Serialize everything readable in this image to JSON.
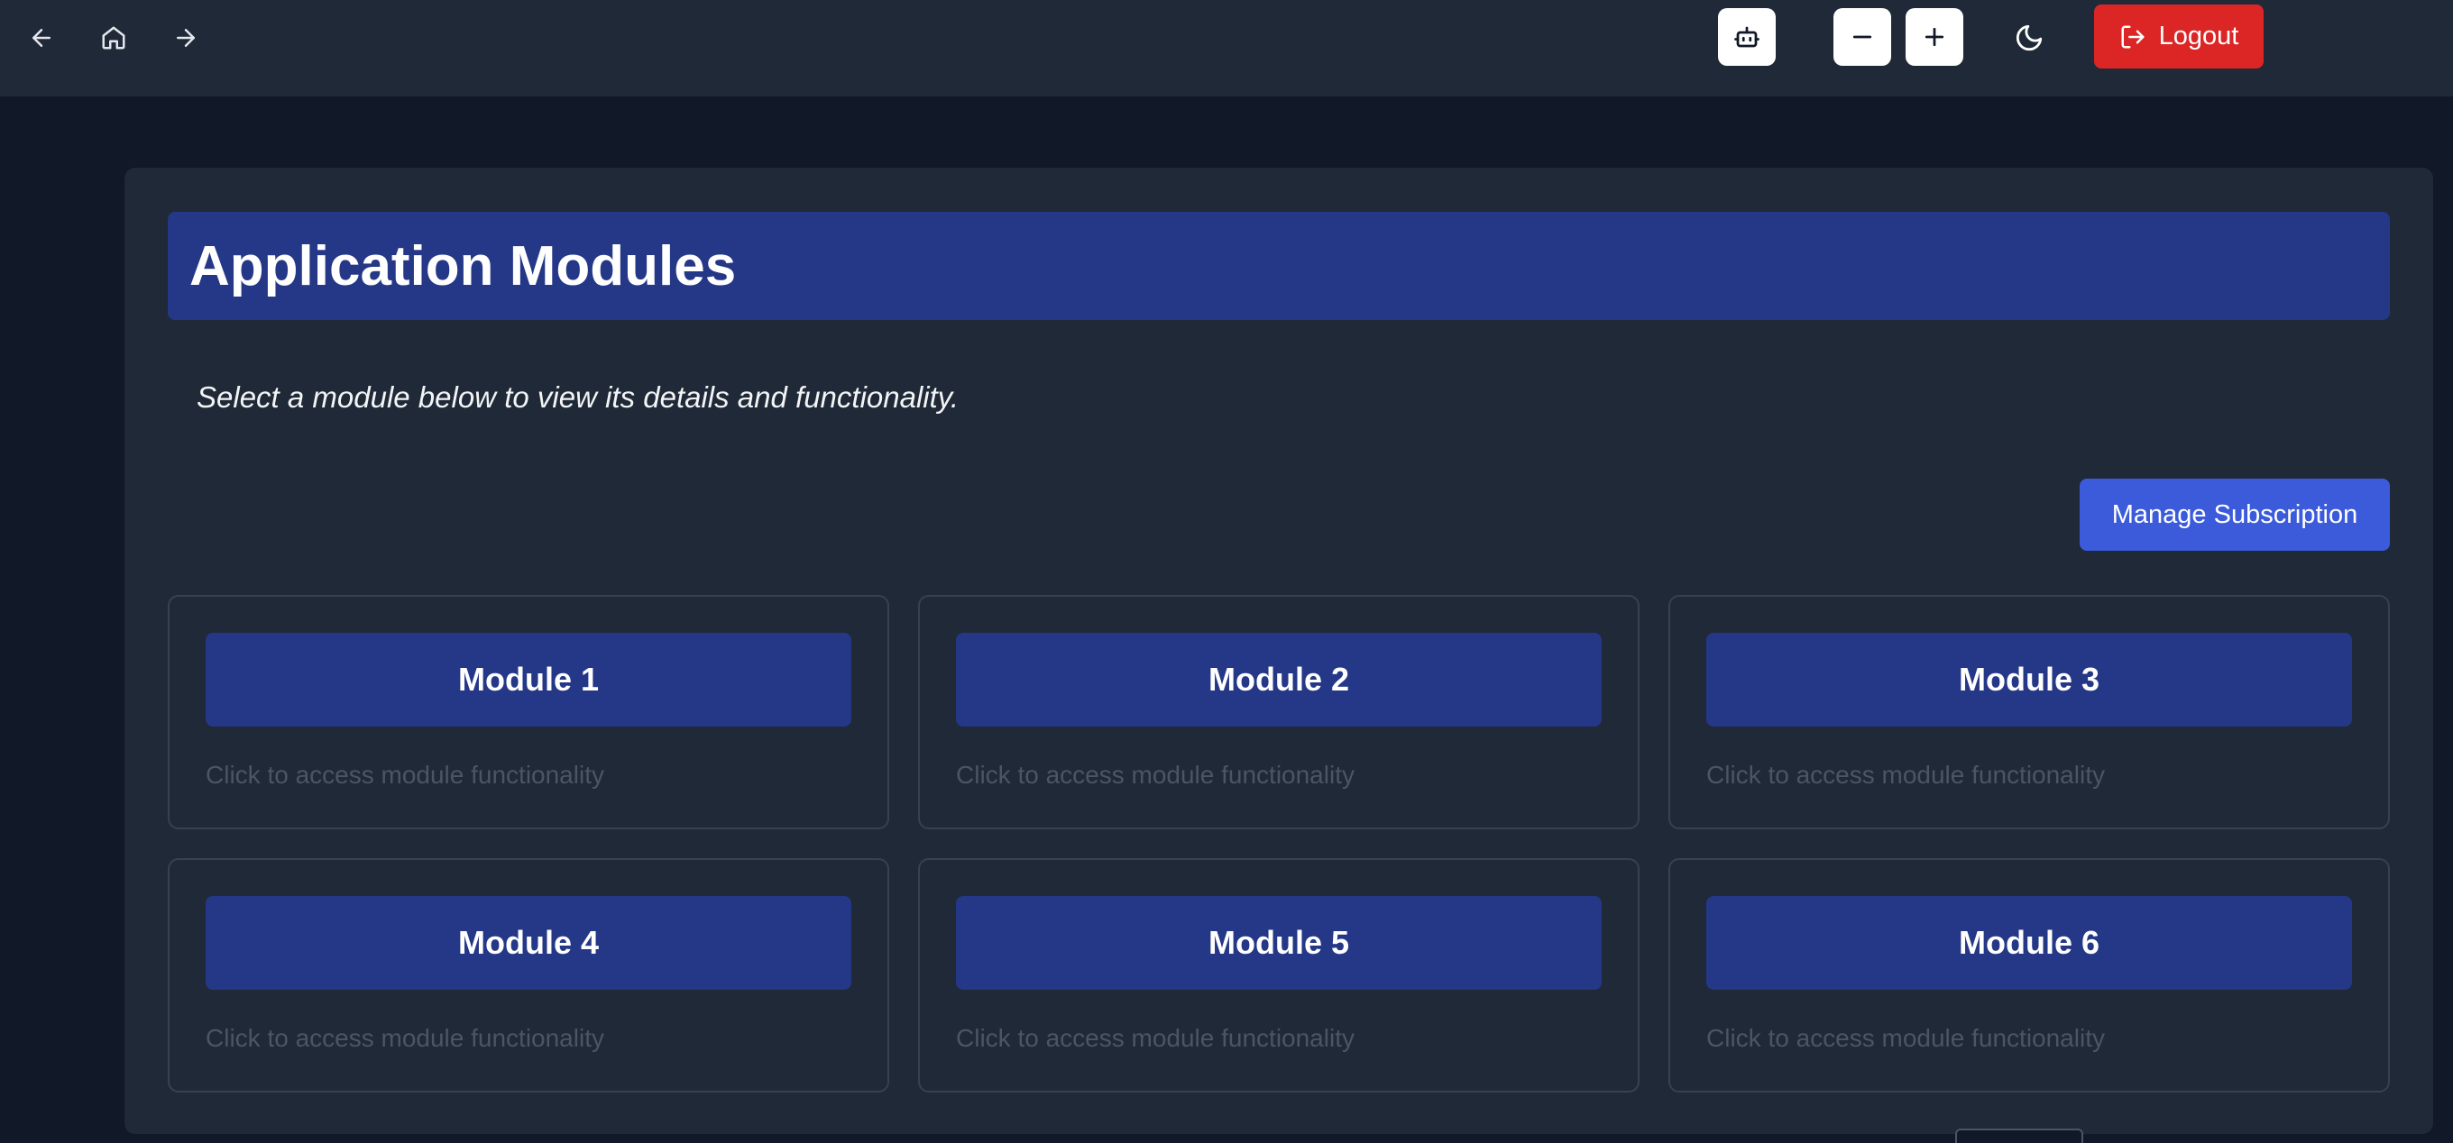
{
  "toolbar": {
    "back_icon": "arrow-left-icon",
    "home_icon": "home-icon",
    "forward_icon": "arrow-right-icon",
    "robot_icon": "robot-icon",
    "zoom_out_icon": "minus-icon",
    "zoom_in_icon": "plus-icon",
    "theme_icon": "moon-icon",
    "logout_label": "Logout",
    "logout_color": "#dc2626"
  },
  "main": {
    "title": "Application Modules",
    "subtitle": "Select a module below to view its details and functionality.",
    "manage_label": "Manage Subscription",
    "accent": "#253887",
    "modules": [
      {
        "label": "Module 1",
        "description": "Click to access module functionality"
      },
      {
        "label": "Module 2",
        "description": "Click to access module functionality"
      },
      {
        "label": "Module 3",
        "description": "Click to access module functionality"
      },
      {
        "label": "Module 4",
        "description": "Click to access module functionality"
      },
      {
        "label": "Module 5",
        "description": "Click to access module functionality"
      },
      {
        "label": "Module 6",
        "description": "Click to access module functionality"
      }
    ]
  }
}
